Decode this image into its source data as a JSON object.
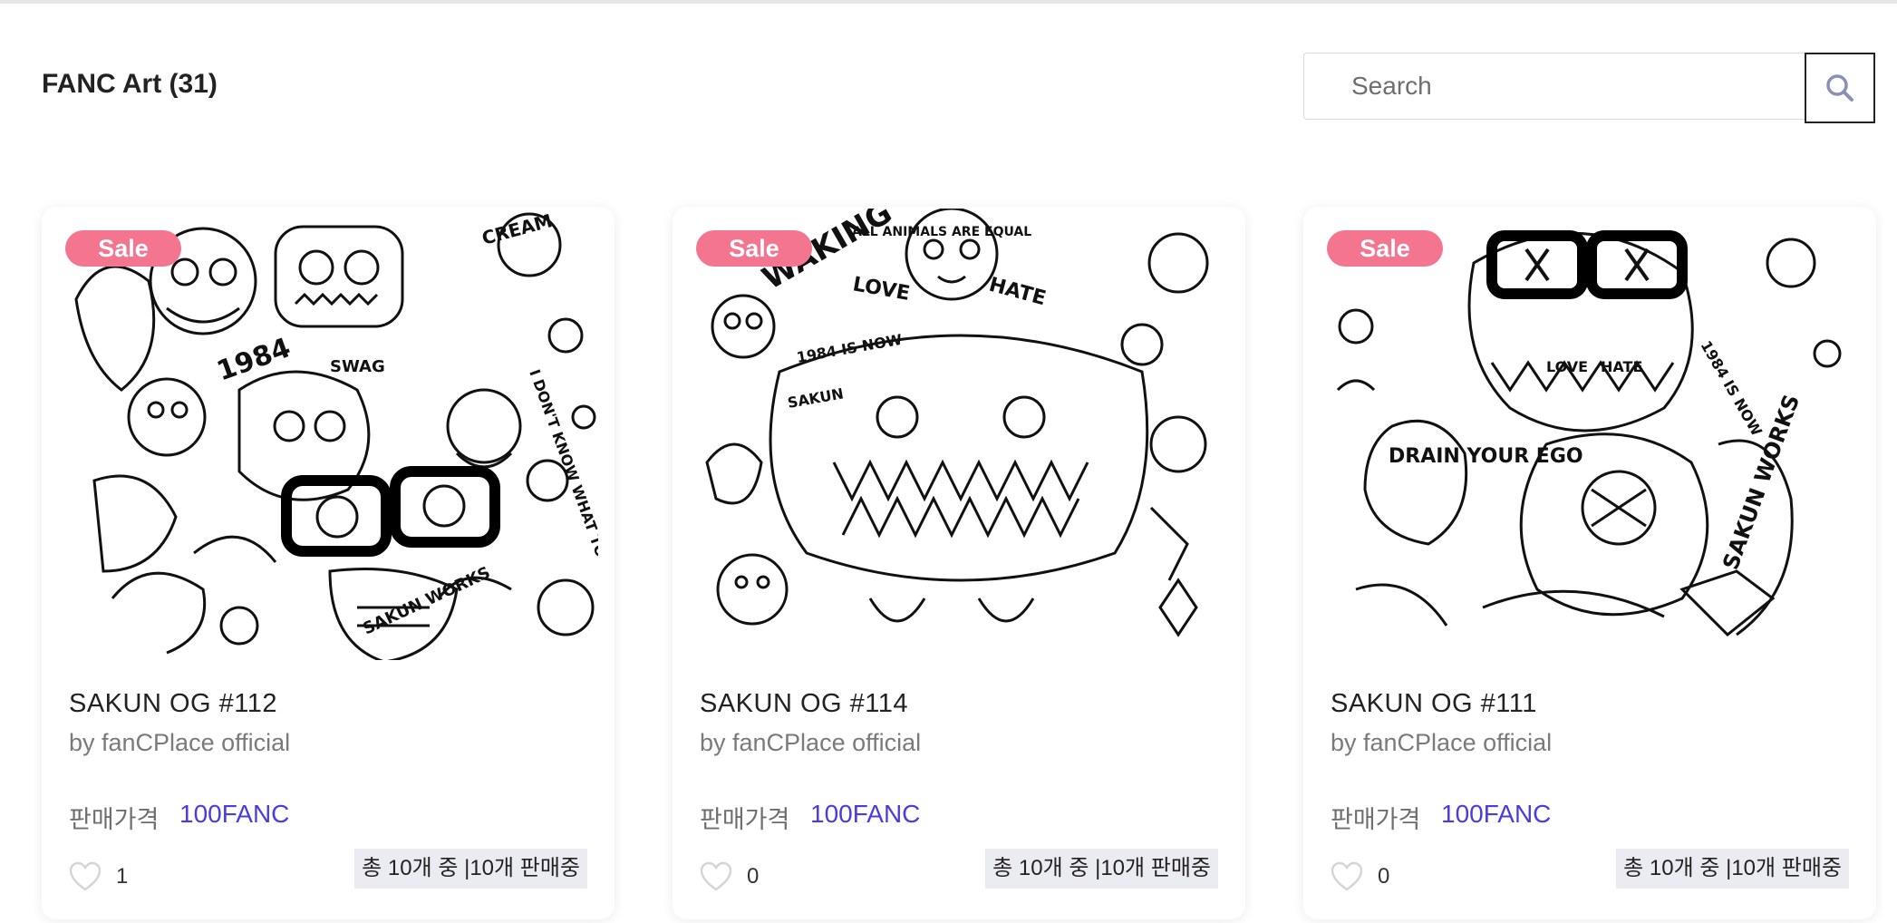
{
  "header": {
    "title": "FANC Art (31)"
  },
  "search": {
    "placeholder": "Search",
    "value": ""
  },
  "colors": {
    "sale_badge": "#f3758f",
    "price": "#4a3ce0",
    "stock_badge_bg": "#ebebf2"
  },
  "cards": [
    {
      "badge": "Sale",
      "title": "SAKUN OG #112",
      "creator": "by fanCPlace official",
      "price_label": "판매가격",
      "price": "100FANC",
      "likes": "1",
      "stock": "총 10개 중 |10개 판매중",
      "image_scribbles": [
        "CREAM",
        "1984",
        "SWAG",
        "SAKUN WORKS",
        "I DON'T KNOW WHAT TO DO"
      ]
    },
    {
      "badge": "Sale",
      "title": "SAKUN OG #114",
      "creator": "by fanCPlace official",
      "price_label": "판매가격",
      "price": "100FANC",
      "likes": "0",
      "stock": "총 10개 중 |10개 판매중",
      "image_scribbles": [
        "WAKING",
        "ALL ANIMALS ARE EQUAL",
        "LOVE",
        "HATE",
        "SAKUN",
        "1984 IS NOW"
      ]
    },
    {
      "badge": "Sale",
      "title": "SAKUN OG #111",
      "creator": "by fanCPlace official",
      "price_label": "판매가격",
      "price": "100FANC",
      "likes": "0",
      "stock": "총 10개 중 |10개 판매중",
      "image_scribbles": [
        "DRAIN YOUR EGO",
        "LOVE",
        "HATE",
        "SAKUN WORKS",
        "1984 IS NOW"
      ]
    }
  ]
}
